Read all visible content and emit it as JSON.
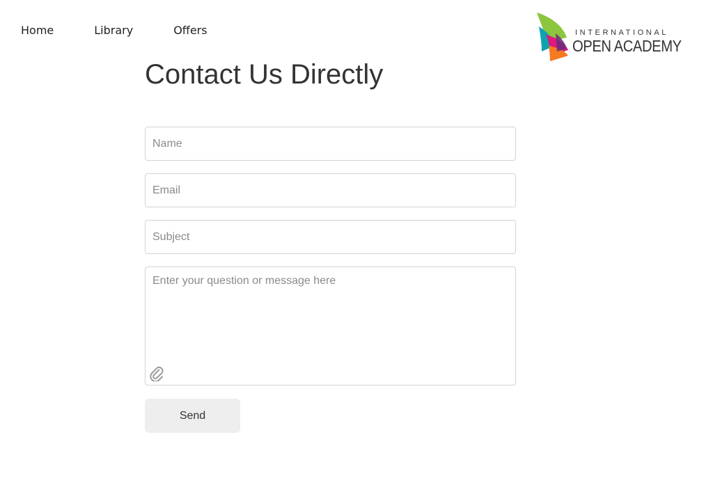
{
  "nav": {
    "items": [
      {
        "label": "Home"
      },
      {
        "label": "Library"
      },
      {
        "label": "Offers"
      }
    ]
  },
  "logo": {
    "line1": "INTERNATIONAL",
    "line2": "OPEN ACADEMY",
    "colors": [
      "#8cc63f",
      "#0fa3b1",
      "#e0197d",
      "#f47b20",
      "#6b2a7a"
    ]
  },
  "page": {
    "title": "Contact Us Directly"
  },
  "form": {
    "name_placeholder": "Name",
    "email_placeholder": "Email",
    "subject_placeholder": "Subject",
    "message_placeholder": "Enter your question or message here",
    "attach_icon": "paperclip-icon",
    "send_label": "Send"
  }
}
